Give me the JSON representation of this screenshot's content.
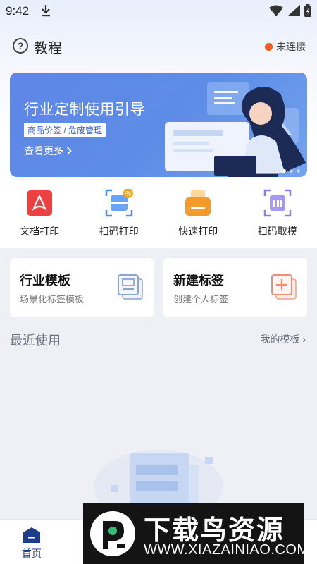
{
  "status_bar": {
    "time": "9:42"
  },
  "header": {
    "title": "教程",
    "connection_status": "未连接"
  },
  "banner": {
    "title": "行业定制使用引导",
    "tags": "商品价签 / 危废管理",
    "more_label": "查看更多",
    "page_count": 3,
    "active_page": 1
  },
  "quick_actions": [
    {
      "label": "文档打印",
      "icon": "pdf-document-icon",
      "color": "#ec4142"
    },
    {
      "label": "扫码打印",
      "icon": "scan-print-icon",
      "color": "#4c8bf0"
    },
    {
      "label": "快速打印",
      "icon": "printer-icon",
      "color": "#f39a2c"
    },
    {
      "label": "扫码取模",
      "icon": "scan-template-icon",
      "color": "#8a7cf5"
    }
  ],
  "cards": [
    {
      "title": "行业模板",
      "subtitle": "场景化标签模板",
      "icon": "template-icon"
    },
    {
      "title": "新建标签",
      "subtitle": "创建个人标签",
      "icon": "add-label-icon"
    }
  ],
  "recent": {
    "title": "最近使用",
    "more_label": "我的模板"
  },
  "bottom_nav": {
    "home_label": "首页"
  },
  "watermark": {
    "title": "下载鸟资源",
    "url": "WWW.XIAZAINIAO.COM"
  },
  "colors": {
    "accent": "#1f3c88",
    "banner": "#5f86e8",
    "status_dot": "#f15a22"
  }
}
